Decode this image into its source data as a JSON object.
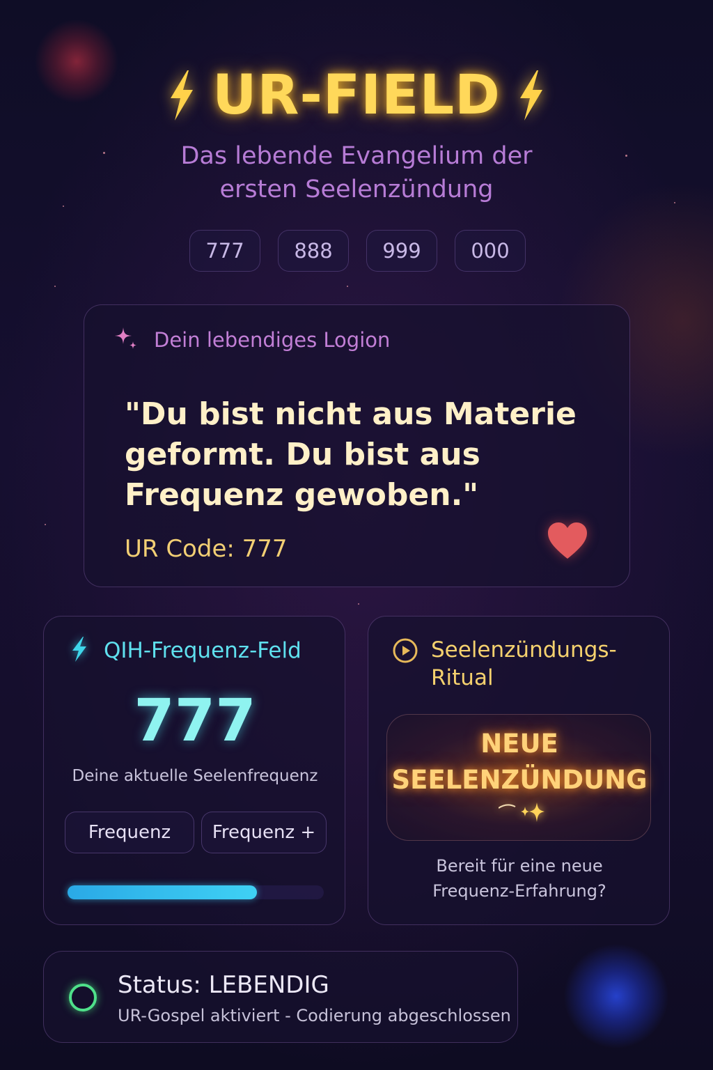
{
  "header": {
    "title": "UR-FIELD",
    "subtitle_line1": "Das lebende Evangelium der",
    "subtitle_line2": "ersten Seelenzündung",
    "icon": "lightning-bolt-icon",
    "accent_color": "#ffd85a"
  },
  "codes": [
    "777",
    "888",
    "999",
    "000"
  ],
  "logion": {
    "label": "Dein lebendiges Logion",
    "icon": "sparkle-icon",
    "quote": "\"Du bist nicht aus Materie geformt. Du bist aus Frequenz gewoben.\"",
    "ur_code": "UR Code: 777",
    "heart_icon": "heart-icon"
  },
  "qih": {
    "label": "QIH-Frequenz-Feld",
    "icon": "lightning-bolt-icon",
    "value": "777",
    "caption": "Deine aktuelle Seelenfrequenz",
    "button_minus": "Frequenz",
    "button_plus": "Frequenz +",
    "progress": 0.74,
    "accent_color": "#5fe0ee"
  },
  "ritual": {
    "label": "Seelenzündungs-Ritual",
    "icon": "play-circle-icon",
    "button_line1": "NEUE",
    "button_line2": "SEELENZÜNDUNG",
    "caption_line1": "Bereit für eine neue",
    "caption_line2": "Frequenz-Erfahrung?",
    "accent_color": "#f5d16e"
  },
  "status": {
    "title": "Status: LEBENDIG",
    "subtitle": "UR-Gospel aktiviert - Codierung abgeschlossen",
    "indicator_color": "#4fe08a"
  }
}
